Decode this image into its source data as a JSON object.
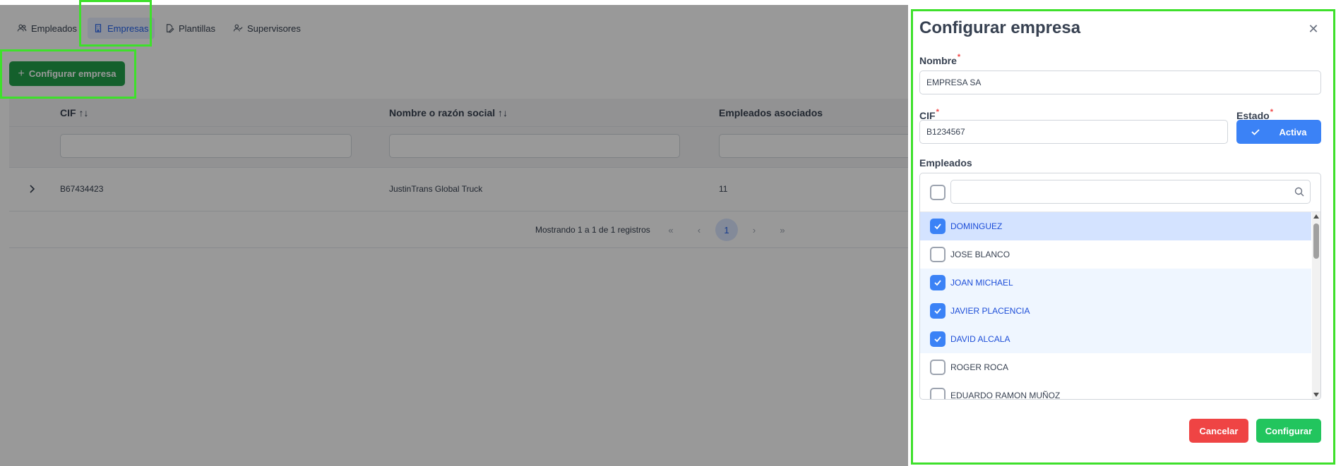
{
  "tabs": [
    {
      "label": "Empleados",
      "icon": "users-icon"
    },
    {
      "label": "Empresas",
      "icon": "building-icon",
      "active": true
    },
    {
      "label": "Plantillas",
      "icon": "file-edit-icon"
    },
    {
      "label": "Supervisores",
      "icon": "user-check-icon"
    }
  ],
  "toolbar": {
    "new_button_label": "Configurar empresa",
    "new_button_icon": "plus-icon"
  },
  "table": {
    "columns": [
      "CIF",
      "Nombre o razón social",
      "Empleados asociados"
    ],
    "rows": [
      {
        "cif": "B67434423",
        "nombre": "JustinTrans Global Truck",
        "empleados": "11"
      }
    ],
    "paginator": {
      "text": "Mostrando 1 a 1 de 1 registros",
      "first": "«",
      "prev": "‹",
      "current": "1",
      "next": "›",
      "last": "»"
    }
  },
  "dialog": {
    "title": "Configurar empresa",
    "close_icon": "close-icon",
    "nombre_label": "Nombre",
    "nombre_value": "EMPRESA SA",
    "cif_label": "CIF",
    "cif_value": "B1234567",
    "estado_label": "Estado",
    "estado_value": "Activa",
    "required_mark": "*",
    "empleados_label": "Empleados",
    "empleados": [
      {
        "name": "DOMINGUEZ",
        "checked": true
      },
      {
        "name": "JOSE BLANCO",
        "checked": false
      },
      {
        "name": "JOAN MICHAEL",
        "checked": true
      },
      {
        "name": "JAVIER PLACENCIA",
        "checked": true
      },
      {
        "name": "DAVID ALCALA",
        "checked": true
      },
      {
        "name": "ROGER ROCA",
        "checked": false
      },
      {
        "name": "EDUARDO RAMON MUÑOZ",
        "checked": false
      }
    ],
    "cancel_label": "Cancelar",
    "confirm_label": "Configurar"
  },
  "colors": {
    "accent": "#3b82f6",
    "success": "#22c55e",
    "danger": "#ef4444",
    "highlight": "#3ee02b"
  }
}
